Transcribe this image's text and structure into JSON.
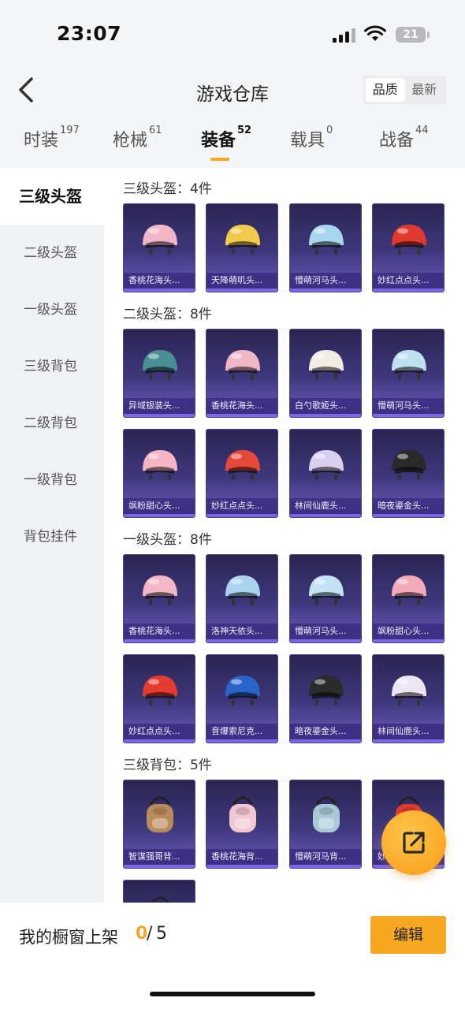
{
  "status_bar": {
    "time": "23:07",
    "battery": "21"
  },
  "header": {
    "title": "游戏仓库",
    "sort_options": [
      "品质",
      "最新"
    ],
    "sort_active": 0
  },
  "tabs": [
    {
      "label": "时装",
      "count": "197"
    },
    {
      "label": "枪械",
      "count": "61"
    },
    {
      "label": "装备",
      "count": "52"
    },
    {
      "label": "载具",
      "count": "0"
    },
    {
      "label": "战备",
      "count": "44"
    }
  ],
  "active_tab": 2,
  "accent_color": "#f5a623",
  "sidebar": {
    "items": [
      "三级头盔",
      "二级头盔",
      "一级头盔",
      "三级背包",
      "二级背包",
      "一级背包",
      "背包挂件"
    ],
    "active": 0
  },
  "sections": [
    {
      "title": "三级头盔：4件",
      "items": [
        {
          "name": "香桃花海头...",
          "color": "#f3b6c8"
        },
        {
          "name": "天降萌叽头...",
          "color": "#f2c94c"
        },
        {
          "name": "懵萌河马头...",
          "color": "#a9d6ef"
        },
        {
          "name": "妙红点点头...",
          "color": "#e0392f"
        }
      ]
    },
    {
      "title": "二级头盔：8件",
      "items": [
        {
          "name": "异域银装头...",
          "color": "#4a8e95"
        },
        {
          "name": "香桃花海头...",
          "color": "#f2b7c6"
        },
        {
          "name": "白勺歌姬头...",
          "color": "#f1ece2"
        },
        {
          "name": "懵萌河马头...",
          "color": "#bfe0f0"
        },
        {
          "name": "飒粉甜心头...",
          "color": "#f6b4c4"
        },
        {
          "name": "妙红点点头...",
          "color": "#e4483b"
        },
        {
          "name": "林间仙鹿头...",
          "color": "#d9cfee"
        },
        {
          "name": "暗夜鎏金头...",
          "color": "#2a2a2a"
        }
      ]
    },
    {
      "title": "一级头盔：8件",
      "items": [
        {
          "name": "香桃花海头...",
          "color": "#f3b7c6"
        },
        {
          "name": "洛神天依头...",
          "color": "#a9d3ee"
        },
        {
          "name": "懵萌河马头...",
          "color": "#c3e3f4"
        },
        {
          "name": "飒粉甜心头...",
          "color": "#f3a9b8"
        },
        {
          "name": "妙红点点头...",
          "color": "#e63b30"
        },
        {
          "name": "音爆索尼克...",
          "color": "#2b64c9"
        },
        {
          "name": "暗夜鎏金头...",
          "color": "#2b2b2b"
        },
        {
          "name": "林间仙鹿头...",
          "color": "#ece6f4"
        }
      ]
    },
    {
      "title": "三级背包：5件",
      "items": [
        {
          "name": "智谋强哥背...",
          "color": "#b88b5a"
        },
        {
          "name": "香桃花海背...",
          "color": "#f1c7d2"
        },
        {
          "name": "懵萌河马背...",
          "color": "#a9c9d6"
        },
        {
          "name": "妙红点点背...",
          "color": "#e23a2f"
        },
        {
          "name": "",
          "color": "#8a8a8a"
        }
      ]
    }
  ],
  "bottom_bar": {
    "label": "我的橱窗上架",
    "current": "0",
    "slash": "/",
    "max": "5",
    "edit_label": "编辑"
  },
  "icons": {
    "back": "chevron-left-icon",
    "share": "share-external-icon"
  }
}
